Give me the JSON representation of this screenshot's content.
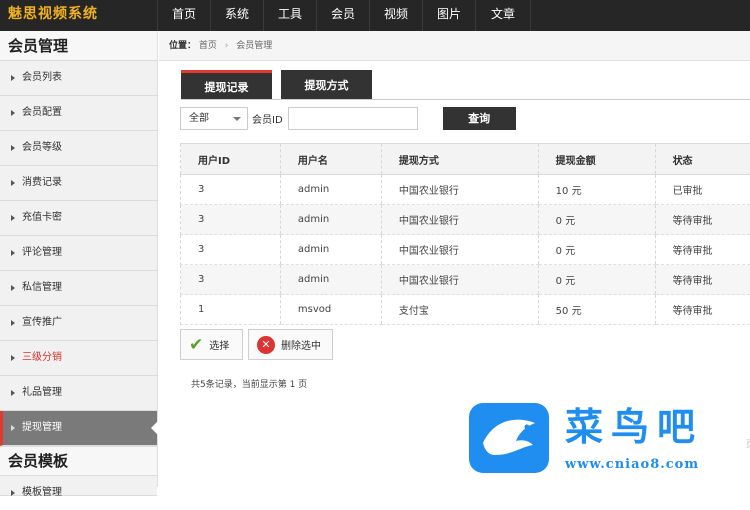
{
  "app": {
    "logo": "魅思视频系统"
  },
  "topnav": [
    "首页",
    "系统",
    "工具",
    "会员",
    "视频",
    "图片",
    "文章"
  ],
  "sidebar": {
    "section1": "会员管理",
    "items": [
      {
        "label": "会员列表"
      },
      {
        "label": "会员配置"
      },
      {
        "label": "会员等级"
      },
      {
        "label": "消费记录"
      },
      {
        "label": "充值卡密"
      },
      {
        "label": "评论管理"
      },
      {
        "label": "私信管理"
      },
      {
        "label": "宣传推广"
      },
      {
        "label": "三级分销"
      },
      {
        "label": "礼品管理"
      },
      {
        "label": "提现管理"
      }
    ],
    "section2": "会员模板",
    "items2": [
      {
        "label": "模板管理"
      }
    ]
  },
  "breadcrumb": {
    "prefix": "位置：",
    "home": "首页",
    "sep": "›",
    "current": "会员管理"
  },
  "tabs": [
    "提现记录",
    "提现方式"
  ],
  "filter": {
    "select_value": "全部",
    "member_label": "会员ID",
    "member_value": "",
    "query_label": "查询"
  },
  "table": {
    "headers": [
      "用户ID",
      "用户名",
      "提现方式",
      "提现金额",
      "状态"
    ],
    "rows": [
      [
        "3",
        "admin",
        "中国农业银行",
        "10 元",
        "已审批"
      ],
      [
        "3",
        "admin",
        "中国农业银行",
        "0 元",
        "等待审批"
      ],
      [
        "3",
        "admin",
        "中国农业银行",
        "0 元",
        "等待审批"
      ],
      [
        "3",
        "admin",
        "中国农业银行",
        "0 元",
        "等待审批"
      ],
      [
        "1",
        "msvod",
        "支付宝",
        "50 元",
        "等待审批"
      ]
    ]
  },
  "actions": {
    "select_label": "选择",
    "delete_label": "删除选中"
  },
  "summary": "共5条记录，当前显示第 1 页",
  "watermark": {
    "text": "菜鸟吧",
    "url": "www.cniao8.com",
    "edge": "页"
  },
  "colors": {
    "accent_red": "#e23a2f",
    "dark": "#333333",
    "watermark_blue": "#1f8ef0"
  }
}
